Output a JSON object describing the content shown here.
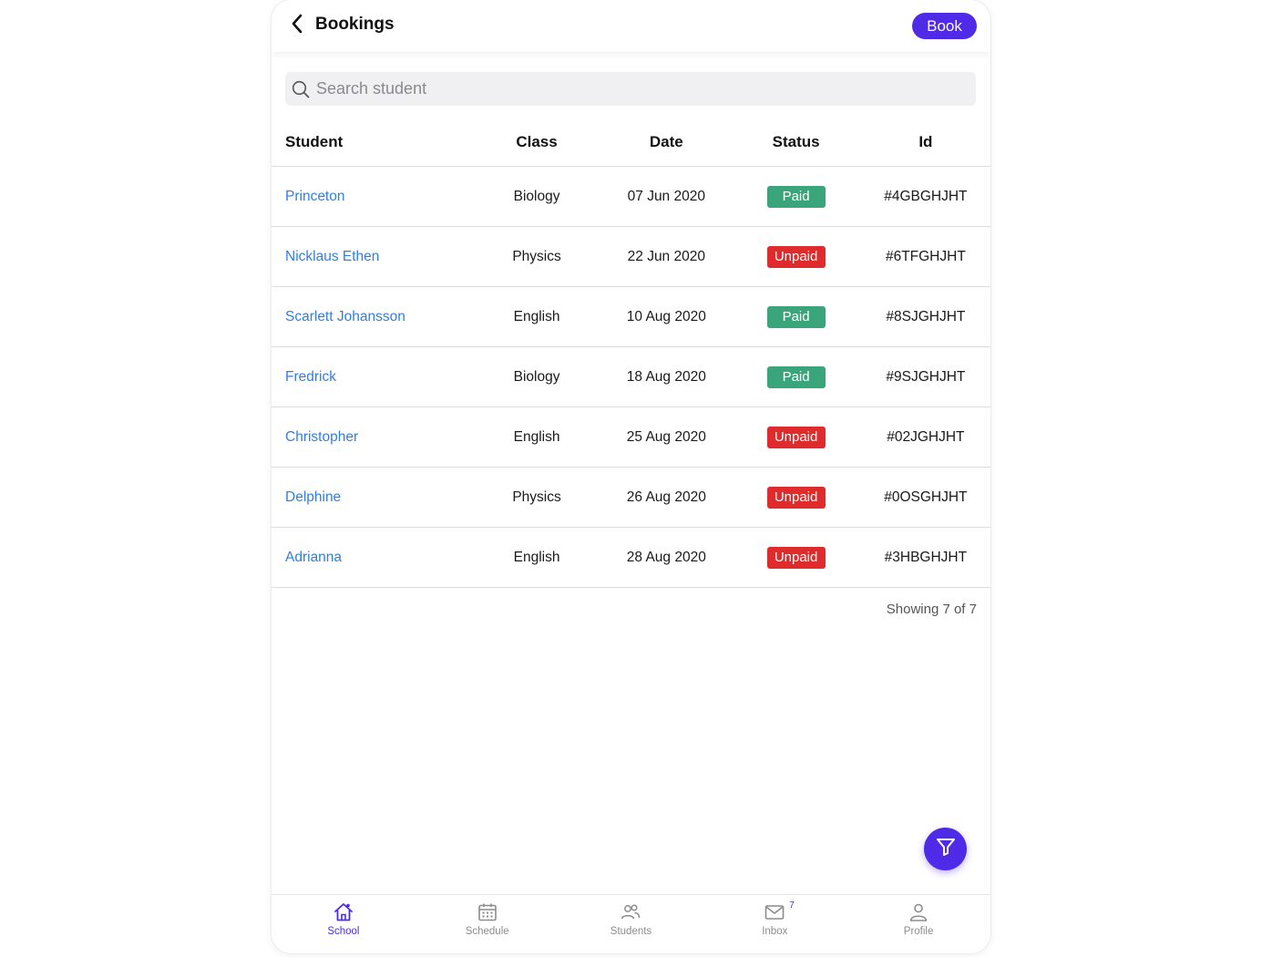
{
  "header": {
    "title": "Bookings",
    "book_label": "Book",
    "back_icon": "chevron-left-icon"
  },
  "search": {
    "placeholder": "Search student",
    "value": ""
  },
  "table": {
    "columns": [
      "Student",
      "Class",
      "Date",
      "Status",
      "Id"
    ],
    "rows": [
      {
        "student": "Princeton",
        "class": "Biology",
        "date": "07 Jun 2020",
        "status": "Paid",
        "id": "#4GBGHJHT"
      },
      {
        "student": "Nicklaus Ethen",
        "class": "Physics",
        "date": "22 Jun 2020",
        "status": "Unpaid",
        "id": "#6TFGHJHT"
      },
      {
        "student": "Scarlett Johansson",
        "class": "English",
        "date": "10 Aug 2020",
        "status": "Paid",
        "id": "#8SJGHJHT"
      },
      {
        "student": "Fredrick",
        "class": "Biology",
        "date": "18 Aug 2020",
        "status": "Paid",
        "id": "#9SJGHJHT"
      },
      {
        "student": "Christopher",
        "class": "English",
        "date": "25 Aug 2020",
        "status": "Unpaid",
        "id": "#02JGHJHT"
      },
      {
        "student": "Delphine",
        "class": "Physics",
        "date": "26 Aug 2020",
        "status": "Unpaid",
        "id": "#0OSGHJHT"
      },
      {
        "student": "Adrianna",
        "class": "English",
        "date": "28 Aug 2020",
        "status": "Unpaid",
        "id": "#3HBGHJHT"
      }
    ],
    "showing": "Showing 7 of 7"
  },
  "colors": {
    "accent": "#4f2be8",
    "paid": "#3aa57a",
    "unpaid": "#df2b2b",
    "link": "#2f7fe0"
  },
  "fab": {
    "icon": "filter-icon"
  },
  "tabbar": {
    "tabs": [
      {
        "label": "School",
        "icon": "home-icon",
        "active": true
      },
      {
        "label": "Schedule",
        "icon": "calendar-icon",
        "active": false
      },
      {
        "label": "Students",
        "icon": "users-icon",
        "active": false
      },
      {
        "label": "Inbox",
        "icon": "mail-icon",
        "active": false,
        "badge": "7"
      },
      {
        "label": "Profile",
        "icon": "user-icon",
        "active": false
      }
    ]
  }
}
